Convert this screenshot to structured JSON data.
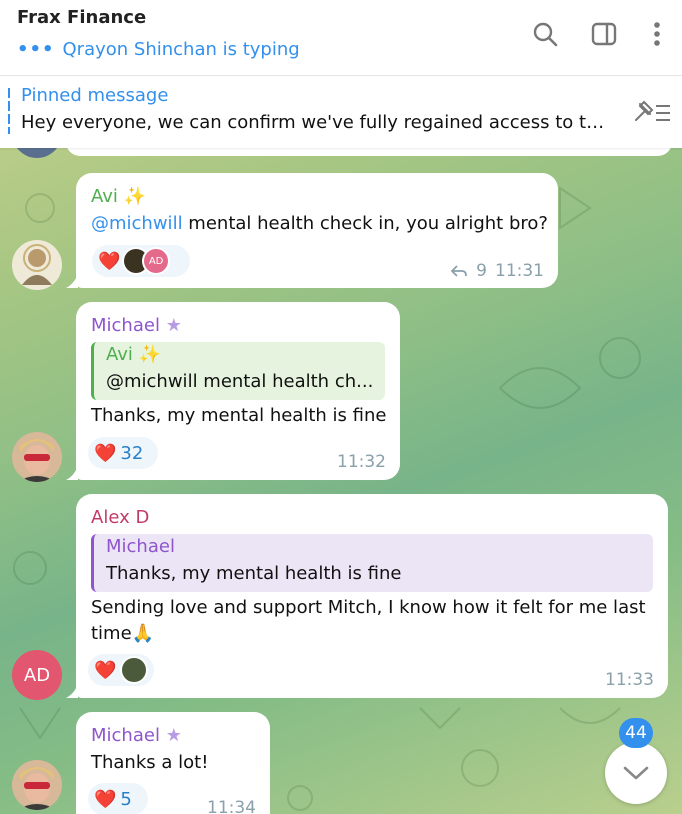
{
  "header": {
    "title": "Frax Finance",
    "typing_dots": "•••",
    "typing_text": "Qrayon Shinchan is typing"
  },
  "pinned": {
    "title": "Pinned message",
    "text": "Hey everyone, we can confirm we've fully regained access to th..."
  },
  "messages": [
    {
      "sender": "Avi",
      "sender_emoji": "✨",
      "mention": "@michwill",
      "text": " mental health check in, you alright bro?",
      "reaction_emoji": "❤️",
      "reaction_avatar_initials": "AD",
      "forward_count": "9",
      "time": "11:31"
    },
    {
      "sender": "Michael",
      "sender_emoji": "★",
      "reply_name": "Avi",
      "reply_emoji": "✨",
      "reply_text": "@michwill mental health ch...",
      "text": "Thanks, my mental health is fine",
      "reaction_emoji": "❤️",
      "reaction_count": "32",
      "time": "11:32"
    },
    {
      "sender": "Alex D",
      "reply_name": "Michael",
      "reply_text": "Thanks, my mental health is fine",
      "text_line1": "Sending love and support Mitch, I know how it felt for me last",
      "text_line2": "time",
      "text_emoji": "🙏",
      "reaction_emoji": "❤️",
      "avatar_initials": "AD",
      "time": "11:33"
    },
    {
      "sender": "Michael",
      "sender_emoji": "★",
      "text": "Thanks a lot!",
      "reaction_emoji": "❤️",
      "reaction_count": "5",
      "time": "11:34"
    }
  ],
  "unread_badge": "44",
  "colors": {
    "accent": "#3390ec",
    "avi": "#4fae4e",
    "michael": "#8e55cc",
    "alex": "#c03d6a"
  }
}
